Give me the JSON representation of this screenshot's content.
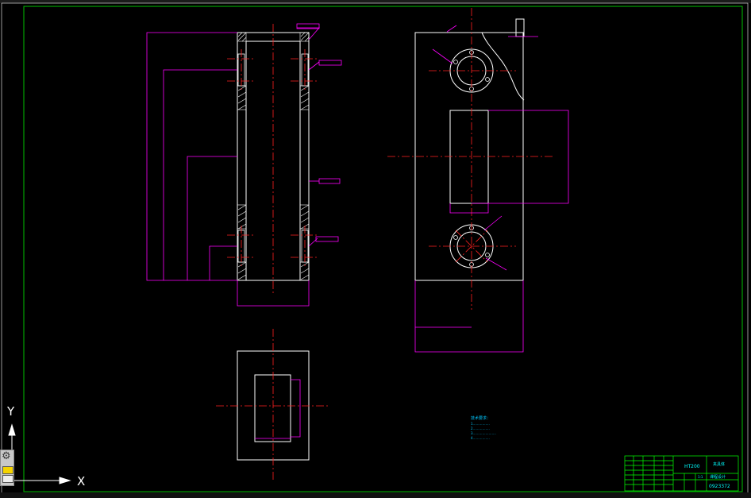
{
  "drawing": {
    "colors": {
      "background": "#000000",
      "outline": "#ffffff",
      "dimension": "#ff00ff",
      "centerline": "#ff2020",
      "border": "#00c000",
      "titleblock": "#00ff00",
      "note_text": "#00c8ff",
      "titleblock_text": "#00ffff"
    },
    "notes": {
      "heading": "技术要求：",
      "lines": [
        "1.……………",
        "2.……………",
        "3.…………………",
        "4.……………"
      ]
    },
    "titleblock": {
      "material": "HT200",
      "part_name": "夹具体",
      "scale": "1:1",
      "drawing_no": "0923372",
      "company": "课程设计"
    }
  },
  "ucs": {
    "x_label": "X",
    "y_label": "Y"
  },
  "toolbar": {
    "settings_icon": "gear-icon"
  }
}
